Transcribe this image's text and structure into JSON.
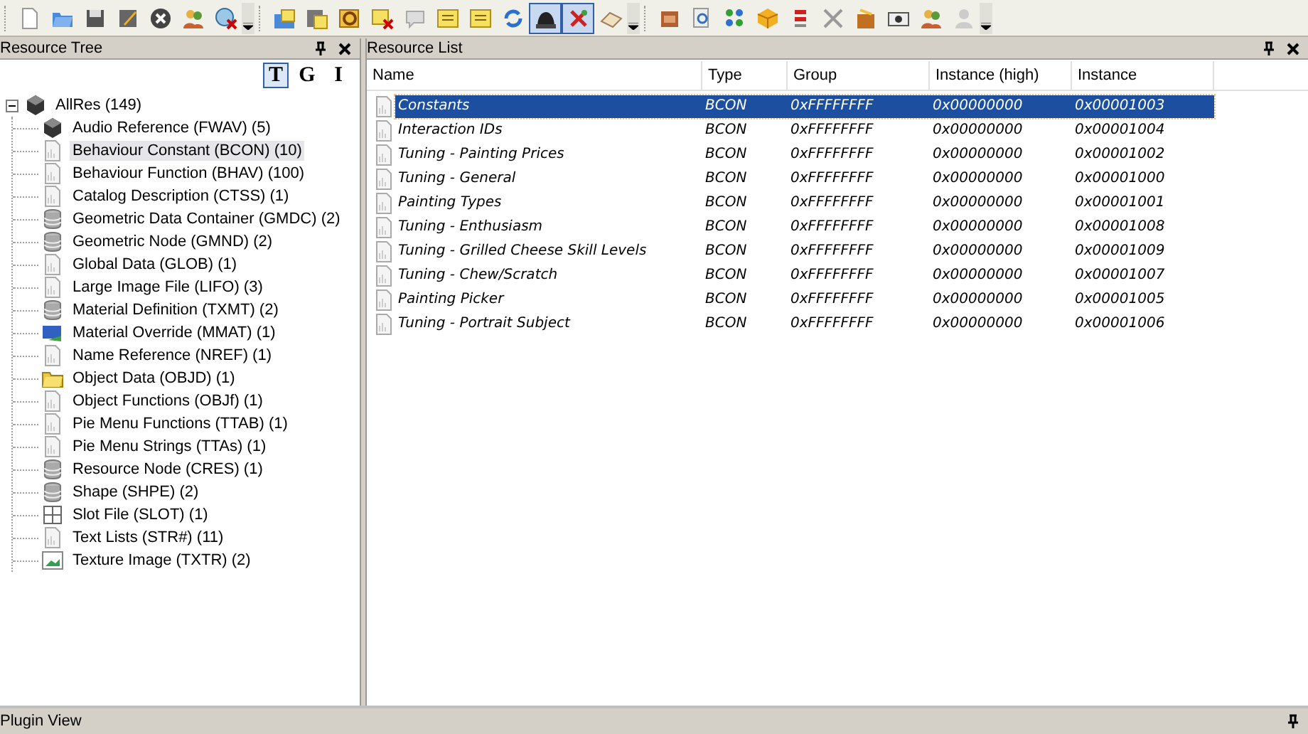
{
  "toolbar": {
    "groups": [
      {
        "items": [
          {
            "kind": "page",
            "pressed": false
          },
          {
            "kind": "folder",
            "pressed": false
          },
          {
            "kind": "disk",
            "pressed": false
          },
          {
            "kind": "disk-pencil",
            "pressed": false
          },
          {
            "kind": "circle-x",
            "pressed": false
          },
          {
            "kind": "people",
            "pressed": false
          },
          {
            "kind": "globe-x",
            "pressed": false
          }
        ]
      },
      {
        "items": [
          {
            "kind": "folder-note",
            "pressed": false
          },
          {
            "kind": "disk-note",
            "pressed": false
          },
          {
            "kind": "note-arrow",
            "pressed": false
          },
          {
            "kind": "note-x",
            "pressed": false
          },
          {
            "kind": "speech",
            "pressed": false
          },
          {
            "kind": "note",
            "pressed": false
          },
          {
            "kind": "note",
            "pressed": false
          },
          {
            "kind": "refresh",
            "pressed": false
          },
          {
            "kind": "helmet",
            "pressed": true
          },
          {
            "kind": "pin-x",
            "pressed": true
          },
          {
            "kind": "eraser",
            "pressed": false
          }
        ]
      },
      {
        "items": [
          {
            "kind": "box",
            "pressed": false
          },
          {
            "kind": "magnifier",
            "pressed": false
          },
          {
            "kind": "grid",
            "pressed": false
          },
          {
            "kind": "cube",
            "pressed": false
          },
          {
            "kind": "bar",
            "pressed": false
          },
          {
            "kind": "tools",
            "pressed": false
          },
          {
            "kind": "package",
            "pressed": false
          },
          {
            "kind": "camera",
            "pressed": false
          },
          {
            "kind": "people",
            "pressed": false
          },
          {
            "kind": "user",
            "pressed": false
          }
        ]
      }
    ]
  },
  "resource_tree": {
    "title": "Resource Tree",
    "view_buttons": [
      {
        "label": "T",
        "selected": true
      },
      {
        "label": "G",
        "selected": false
      },
      {
        "label": "I",
        "selected": false
      }
    ],
    "root": {
      "label": "AllRes (149)",
      "kind": "cube",
      "expanded": true,
      "children": [
        {
          "label": "Audio Reference (FWAV) (5)",
          "kind": "cube",
          "selected": false
        },
        {
          "label": "Behaviour Constant (BCON) (10)",
          "kind": "doc",
          "selected": true
        },
        {
          "label": "Behaviour Function (BHAV) (100)",
          "kind": "doc",
          "selected": false
        },
        {
          "label": "Catalog Description (CTSS) (1)",
          "kind": "doc",
          "selected": false
        },
        {
          "label": "Geometric Data Container (GMDC) (2)",
          "kind": "db",
          "selected": false
        },
        {
          "label": "Geometric Node (GMND) (2)",
          "kind": "db",
          "selected": false
        },
        {
          "label": "Global Data (GLOB) (1)",
          "kind": "doc",
          "selected": false
        },
        {
          "label": "Large Image File (LIFO) (3)",
          "kind": "doc",
          "selected": false
        },
        {
          "label": "Material Definition (TXMT) (2)",
          "kind": "db",
          "selected": false
        },
        {
          "label": "Material Override (MMAT) (1)",
          "kind": "material",
          "selected": false
        },
        {
          "label": "Name Reference (NREF) (1)",
          "kind": "doc",
          "selected": false
        },
        {
          "label": "Object Data (OBJD) (1)",
          "kind": "folder",
          "selected": false
        },
        {
          "label": "Object Functions (OBJf) (1)",
          "kind": "doc",
          "selected": false
        },
        {
          "label": "Pie Menu Functions (TTAB) (1)",
          "kind": "doc",
          "selected": false
        },
        {
          "label": "Pie Menu Strings (TTAs) (1)",
          "kind": "doc",
          "selected": false
        },
        {
          "label": "Resource Node (CRES) (1)",
          "kind": "db",
          "selected": false
        },
        {
          "label": "Shape (SHPE) (2)",
          "kind": "db",
          "selected": false
        },
        {
          "label": "Slot File (SLOT) (1)",
          "kind": "slot",
          "selected": false
        },
        {
          "label": "Text Lists (STR#) (11)",
          "kind": "doc",
          "selected": false
        },
        {
          "label": "Texture Image (TXTR) (2)",
          "kind": "image",
          "selected": false
        }
      ]
    }
  },
  "resource_list": {
    "title": "Resource List",
    "columns": [
      "Name",
      "Type",
      "Group",
      "Instance (high)",
      "Instance"
    ],
    "rows": [
      {
        "cells": [
          "Constants",
          "BCON",
          "0xFFFFFFFF",
          "0x00000000",
          "0x00001003"
        ],
        "selected": true
      },
      {
        "cells": [
          "Interaction IDs",
          "BCON",
          "0xFFFFFFFF",
          "0x00000000",
          "0x00001004"
        ],
        "selected": false
      },
      {
        "cells": [
          "Tuning - Painting Prices",
          "BCON",
          "0xFFFFFFFF",
          "0x00000000",
          "0x00001002"
        ],
        "selected": false
      },
      {
        "cells": [
          "Tuning - General",
          "BCON",
          "0xFFFFFFFF",
          "0x00000000",
          "0x00001000"
        ],
        "selected": false
      },
      {
        "cells": [
          "Painting Types",
          "BCON",
          "0xFFFFFFFF",
          "0x00000000",
          "0x00001001"
        ],
        "selected": false
      },
      {
        "cells": [
          "Tuning - Enthusiasm",
          "BCON",
          "0xFFFFFFFF",
          "0x00000000",
          "0x00001008"
        ],
        "selected": false
      },
      {
        "cells": [
          "Tuning - Grilled Cheese Skill Levels",
          "BCON",
          "0xFFFFFFFF",
          "0x00000000",
          "0x00001009"
        ],
        "selected": false
      },
      {
        "cells": [
          "Tuning - Chew/Scratch",
          "BCON",
          "0xFFFFFFFF",
          "0x00000000",
          "0x00001007"
        ],
        "selected": false
      },
      {
        "cells": [
          "Painting Picker",
          "BCON",
          "0xFFFFFFFF",
          "0x00000000",
          "0x00001005"
        ],
        "selected": false
      },
      {
        "cells": [
          "Tuning - Portrait Subject",
          "BCON",
          "0xFFFFFFFF",
          "0x00000000",
          "0x00001006"
        ],
        "selected": false
      }
    ]
  },
  "plugin_view": {
    "title": "Plugin View"
  }
}
